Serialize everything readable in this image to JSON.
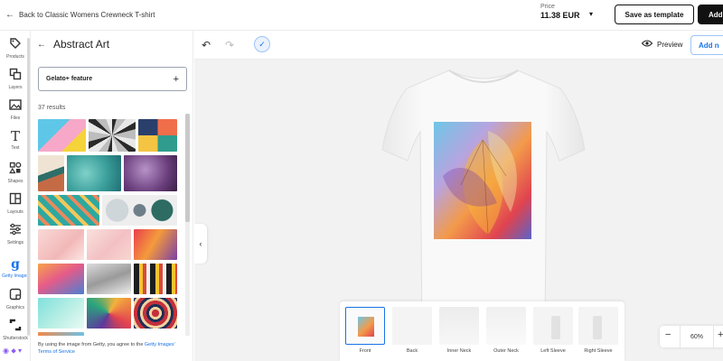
{
  "topbar": {
    "back_label": "Back to Classic Womens Crewneck T-shirt",
    "price_label": "Price",
    "price_value": "11.38 EUR",
    "save_template_label": "Save as template",
    "add_label": "Add"
  },
  "rail": {
    "items": [
      {
        "label": "Products",
        "icon": "tag-icon"
      },
      {
        "label": "Layers",
        "icon": "layers-icon"
      },
      {
        "label": "Files",
        "icon": "image-icon"
      },
      {
        "label": "Text",
        "icon": "text-icon"
      },
      {
        "label": "Shapes",
        "icon": "shapes-icon"
      },
      {
        "label": "Layouts",
        "icon": "layout-icon"
      },
      {
        "label": "Settings",
        "icon": "sliders-icon"
      },
      {
        "label": "Getty Images",
        "icon": "getty-g-icon"
      },
      {
        "label": "Graphics",
        "icon": "graphics-icon"
      },
      {
        "label": "Shutterstock",
        "icon": "shutterstock-icon"
      }
    ]
  },
  "panel": {
    "title": "Abstract Art",
    "feature_label": "Gelato+ feature",
    "results": "37 results",
    "getty_note_prefix": "By using the image from Getty, you agree to the ",
    "getty_link1": "Getty Images'",
    "getty_link2": "Terms of Service"
  },
  "canvas": {
    "preview_label": "Preview",
    "add_label": "Add n",
    "zoom_value": "60%",
    "views": [
      {
        "label": "Front",
        "active": true
      },
      {
        "label": "Back",
        "active": false
      },
      {
        "label": "Inner Neck",
        "active": false
      },
      {
        "label": "Outer Neck",
        "active": false
      },
      {
        "label": "Left Sleeve",
        "active": false
      },
      {
        "label": "Right Sleeve",
        "active": false
      }
    ]
  },
  "colors": {
    "accent": "#1a73e8",
    "dark": "#111111",
    "canvas_bg": "#f2f2f2"
  }
}
